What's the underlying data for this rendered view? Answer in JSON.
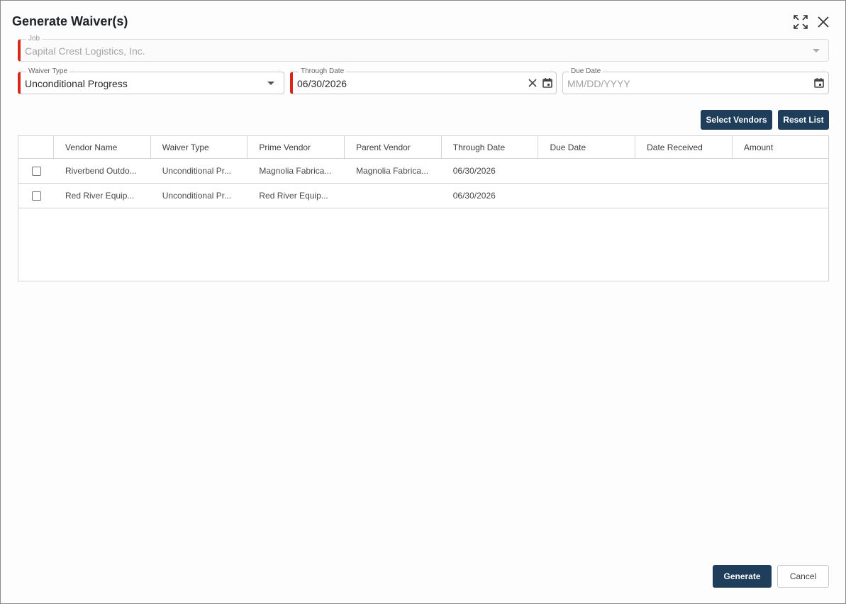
{
  "dialog": {
    "title": "Generate Waiver(s)"
  },
  "form": {
    "job": {
      "label": "Job",
      "value": "Capital Crest Logistics, Inc."
    },
    "waiver_type": {
      "label": "Waiver Type",
      "value": "Unconditional Progress"
    },
    "through_date": {
      "label": "Through Date",
      "value": "06/30/2026"
    },
    "due_date": {
      "label": "Due Date",
      "placeholder": "MM/DD/YYYY"
    }
  },
  "toolbar": {
    "select_vendors_label": "Select Vendors",
    "reset_list_label": "Reset List"
  },
  "grid": {
    "columns": [
      "Vendor Name",
      "Waiver Type",
      "Prime Vendor",
      "Parent Vendor",
      "Through Date",
      "Due Date",
      "Date Received",
      "Amount"
    ],
    "rows": [
      {
        "vendor_name": "Riverbend Outdo...",
        "waiver_type": "Unconditional Pr...",
        "prime_vendor": "Magnolia Fabrica...",
        "parent_vendor": "Magnolia Fabrica...",
        "through_date": "06/30/2026",
        "due_date": "",
        "date_received": "",
        "amount": ""
      },
      {
        "vendor_name": "Red River Equip...",
        "waiver_type": "Unconditional Pr...",
        "prime_vendor": "Red River Equip...",
        "parent_vendor": "",
        "through_date": "06/30/2026",
        "due_date": "",
        "date_received": "",
        "amount": ""
      }
    ]
  },
  "footer": {
    "generate_label": "Generate",
    "cancel_label": "Cancel"
  },
  "colors": {
    "primary": "#1f3e5c",
    "required_marker": "#d9271e"
  }
}
